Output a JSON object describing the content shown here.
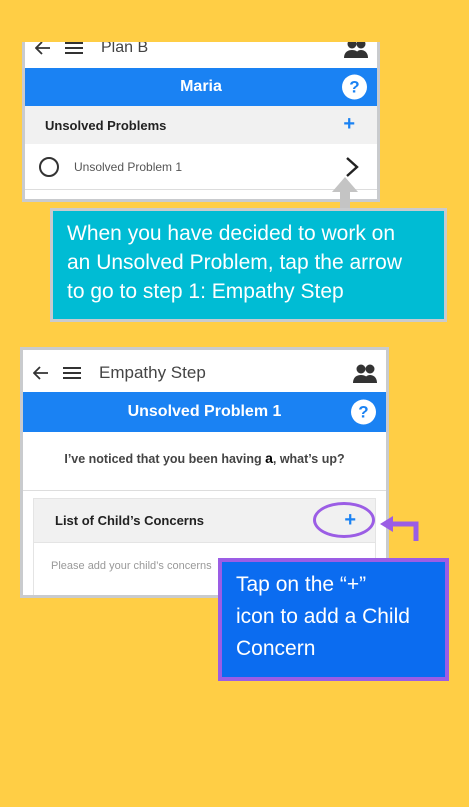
{
  "screen1": {
    "title": "Plan B",
    "banner": "Maria",
    "help_label": "?",
    "section_title": "Unsolved Problems",
    "add_label": "+",
    "item_label": "Unsolved Problem 1"
  },
  "callout1": {
    "line1": "When you have decided to work on",
    "line2": "an Unsolved Problem, tap the arrow",
    "line3": "to go to step 1: Empathy Step"
  },
  "screen2": {
    "title": "Empathy Step",
    "banner": "Unsolved Problem 1",
    "help_label": "?",
    "prompt_before": "I’ve noticed that you been having ",
    "prompt_bold": "a",
    "prompt_after": ", what’s up?",
    "section_title": "List of Child’s Concerns",
    "add_label": "+",
    "placeholder": "Please add your child’s concerns"
  },
  "callout2": {
    "line1": "Tap on the “+”",
    "line2": "icon to add a Child",
    "line3": "Concern"
  },
  "colors": {
    "background": "#FFCE45",
    "accent_blue": "#1A82F3",
    "callout1_bg": "#00BCD4",
    "callout2_bg": "#0B6CF0",
    "highlight_purple": "#9B5DE5"
  }
}
